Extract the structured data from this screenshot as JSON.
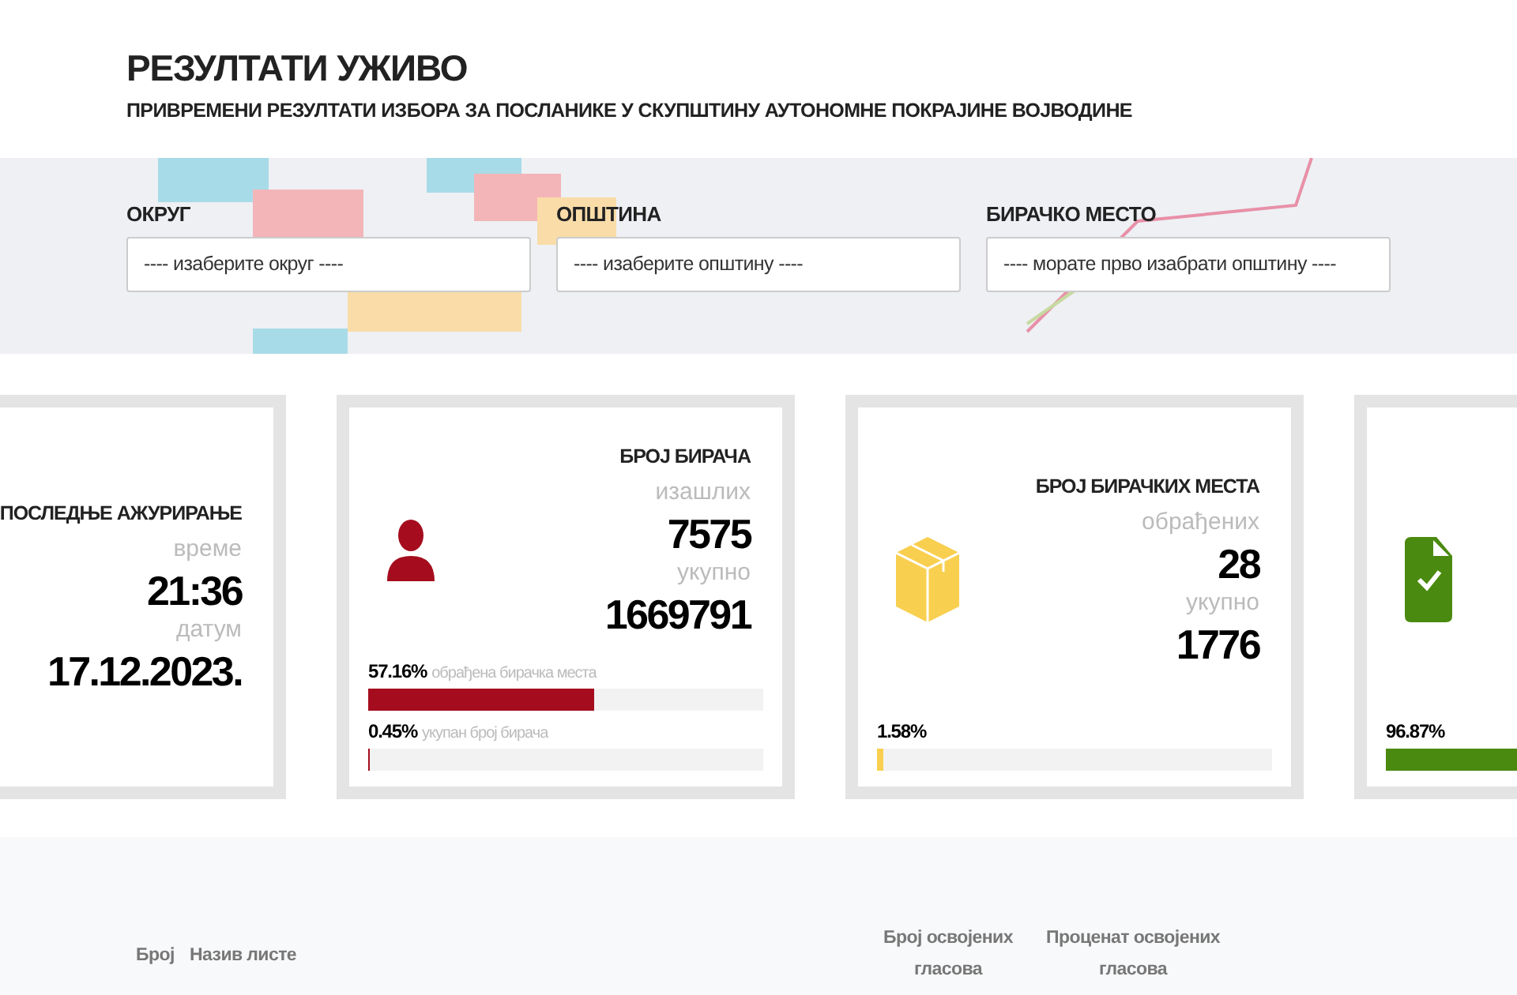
{
  "header": {
    "title": "РЕЗУЛТАТИ УЖИВО",
    "subtitle": "ПРИВРЕМЕНИ РЕЗУЛТАТИ ИЗБОРА ЗА ПОСЛАНИКЕ У СКУПШТИНУ АУТОНОМНЕ ПОКРАЈИНЕ ВОЈВОДИНЕ"
  },
  "filters": [
    {
      "label": "ОКРУГ",
      "value": "---- изаберите округ ----"
    },
    {
      "label": "ОПШТИНА",
      "value": "---- изаберите општину ----"
    },
    {
      "label": "БИРАЧКО МЕСТО",
      "value": "---- морате прво изабрати општину ----"
    }
  ],
  "cards": [
    {
      "kind": "update",
      "title": "ПОСЛЕДЊЕ АЖУРИРАЊЕ",
      "rows": [
        {
          "label": "време",
          "value": "21:36"
        },
        {
          "label": "датум",
          "value": "17.12.2023."
        }
      ]
    },
    {
      "kind": "voters",
      "color": "#a50d1e",
      "title": "БРОЈ БИРАЧА",
      "rows": [
        {
          "label": "изашлих",
          "value": "7575"
        },
        {
          "label": "укупно",
          "value": "1669791"
        }
      ],
      "bars": [
        {
          "percent": "57.16%",
          "caption": "обрађена бирачка места",
          "level": 0.5716
        },
        {
          "percent": "0.45%",
          "caption": "укупан број бирача",
          "level": 0.0045
        }
      ]
    },
    {
      "kind": "stations",
      "color": "#f9cf4f",
      "title": "БРОЈ БИРАЧКИХ МЕСТА",
      "rows": [
        {
          "label": "обрађених",
          "value": "28"
        },
        {
          "label": "укупно",
          "value": "1776"
        }
      ],
      "bars": [
        {
          "percent": "1.58%",
          "level": 0.0158
        }
      ]
    },
    {
      "kind": "valid",
      "color": "#4b8a10",
      "bars": [
        {
          "percent": "96.87%",
          "level": 0.9687
        }
      ]
    }
  ],
  "table": {
    "columns": [
      "Број",
      "Назив листе",
      "Број освојених гласова",
      "Проценат освојених гласова"
    ]
  }
}
